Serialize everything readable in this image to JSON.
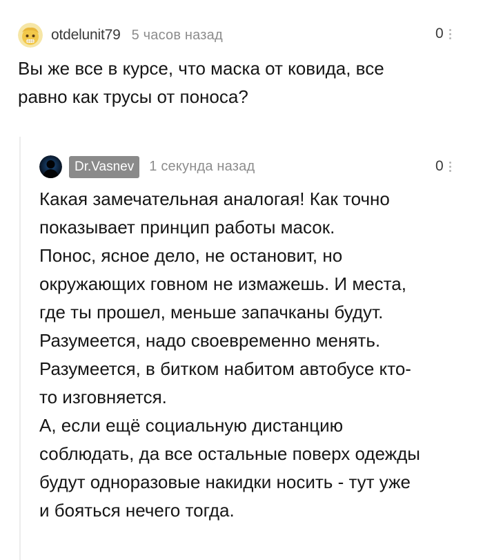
{
  "parent_comment": {
    "username": "otdelunit79",
    "timestamp": "5 часов назад",
    "rating": "0",
    "avatar_icon": "emoji-avatar-icon",
    "text": "Вы же все в курсе, что маска от ковида, все\nравно как трусы от поноса?"
  },
  "reply_comment": {
    "username": "Dr.Vasnev",
    "timestamp": "1 секунда назад",
    "rating": "0",
    "avatar_icon": "dark-silhouette-avatar-icon",
    "text": "Какая замечательная аналогая! Как точно\nпоказывает принцип работы масок.\nПонос, ясное дело, не остановит, но\nокружающих говном не измажешь. И места,\nгде ты прошел, меньше запачканы будут.\nРазумеется, надо своевременно менять.\nРазумеется, в битком набитом автобусе кто-\nто изговняется.\nА, если ещё социальную дистанцию\nсоблюдать, да все остальные поверх одежды\nбудут одноразовые накидки носить - тут уже\nи бояться нечего тогда."
  },
  "colors": {
    "username_badge_bg": "#8a8a8a",
    "timestamp": "#8c8c8c",
    "thread_line": "#ececec",
    "text": "#161616"
  }
}
